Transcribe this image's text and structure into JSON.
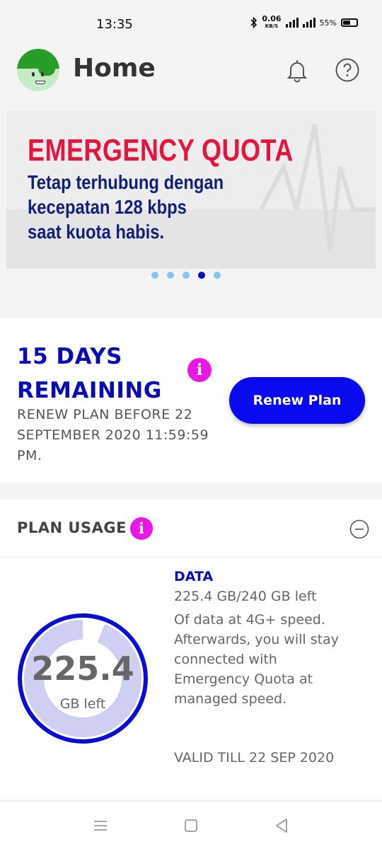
{
  "status_bar": {
    "time": "13:35",
    "net_speed_value": "0.06",
    "net_speed_unit": "KB/S",
    "battery": "55%"
  },
  "header": {
    "title": "Home",
    "icons": [
      "bell-icon",
      "help-icon"
    ]
  },
  "banner": {
    "title": "EMERGENCY QUOTA",
    "subtitle_lines": [
      "Tetap terhubung dengan",
      "kecepatan 128 kbps",
      "saat kuota habis."
    ],
    "slide_count": 5,
    "active_slide": 4
  },
  "plan": {
    "days_line1": "15 DAYS",
    "days_line2": "REMAINING",
    "renew_note": "RENEW PLAN BEFORE 22 SEPTEMBER 2020 11:59:59 PM.",
    "renew_button": "Renew Plan"
  },
  "usage": {
    "title": "PLAN USAGE",
    "gauge_value": "225.4",
    "gauge_unit": "GB left",
    "remaining_fraction": 0.939,
    "data_label": "DATA",
    "data_amount": "225.4 GB/240 GB left",
    "data_desc": "Of data at 4G+ speed. Afterwards, you will stay connected with Emergency Quota at managed speed.",
    "valid_till": "VALID TILL 22 SEP 2020"
  },
  "colors": {
    "primary_blue": "#0b0bb6",
    "button_blue": "#0a0aee",
    "info_magenta": "#ea16e6",
    "banner_red": "#e4163f",
    "gauge_fill": "#cfcff3"
  },
  "nav": [
    "menu-icon",
    "home-icon",
    "back-icon"
  ]
}
